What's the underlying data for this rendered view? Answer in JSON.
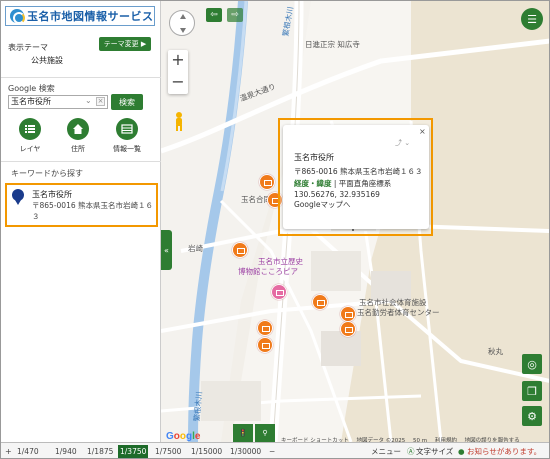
{
  "app": {
    "title": "玉名市地図情報サービス"
  },
  "panel": {
    "theme_label": "表示テーマ",
    "theme_value": "公共施設",
    "theme_change_btn": "テーマ変更 ▶",
    "google_label": "Google 検索",
    "search_value": "玉名市役所",
    "search_btn": "検索",
    "tools": [
      {
        "label": "レイヤ",
        "icon": "layers-icon"
      },
      {
        "label": "住所",
        "icon": "home-icon"
      },
      {
        "label": "情報一覧",
        "icon": "list-icon"
      }
    ],
    "keyword_label": "キーワードから探す",
    "result": {
      "title": "玉名市役所",
      "address": "〒865-0016 熊本県玉名市岩崎１６３"
    }
  },
  "map": {
    "labels": [
      {
        "text": "日進正宗 知広寺",
        "style": ""
      },
      {
        "text": "温泉大通り",
        "style": ""
      },
      {
        "text": "繁根木川",
        "style": ""
      },
      {
        "text": "玉名合同庁",
        "style": ""
      },
      {
        "text": "岩崎",
        "style": ""
      },
      {
        "text": "玉名市立歴史",
        "style": "purple"
      },
      {
        "text": "博物館こころピア",
        "style": "purple"
      },
      {
        "text": "玉名市社会体育施設",
        "style": ""
      },
      {
        "text": "玉名勤労者体育センター",
        "style": ""
      },
      {
        "text": "秋丸",
        "style": ""
      },
      {
        "text": "繁根木川",
        "style": ""
      }
    ],
    "popup": {
      "title": "玉名市役所",
      "address": "〒865-0016 熊本県玉名市岩崎１６３",
      "mode_ll": "経度・緯度",
      "mode_sep": " | ",
      "mode_plane": "平面直角座標系",
      "coords": "130.56276, 32.935169",
      "gmap_link": "Googleマップへ",
      "close": "×",
      "icons": "⤴ ⌄"
    },
    "google_logo": "Google",
    "attribution": [
      "キーボード ショートカット",
      "地図データ ©2025",
      "50 m",
      "利用規約",
      "地図の誤りを報告する"
    ]
  },
  "bottombar": {
    "plus": "+",
    "scales": [
      "1/470",
      "1/940",
      "1/1875",
      "1/3750",
      "1/7500",
      "1/15000",
      "1/30000"
    ],
    "selected_scale": "1/3750",
    "minus": "−",
    "menu": "メニュー",
    "text_size": "文字サイズ",
    "notice": "お知らせがあります。"
  },
  "colors": {
    "accent": "#2e7d32",
    "highlight": "#f39800",
    "brand": "#1a5fa8"
  }
}
